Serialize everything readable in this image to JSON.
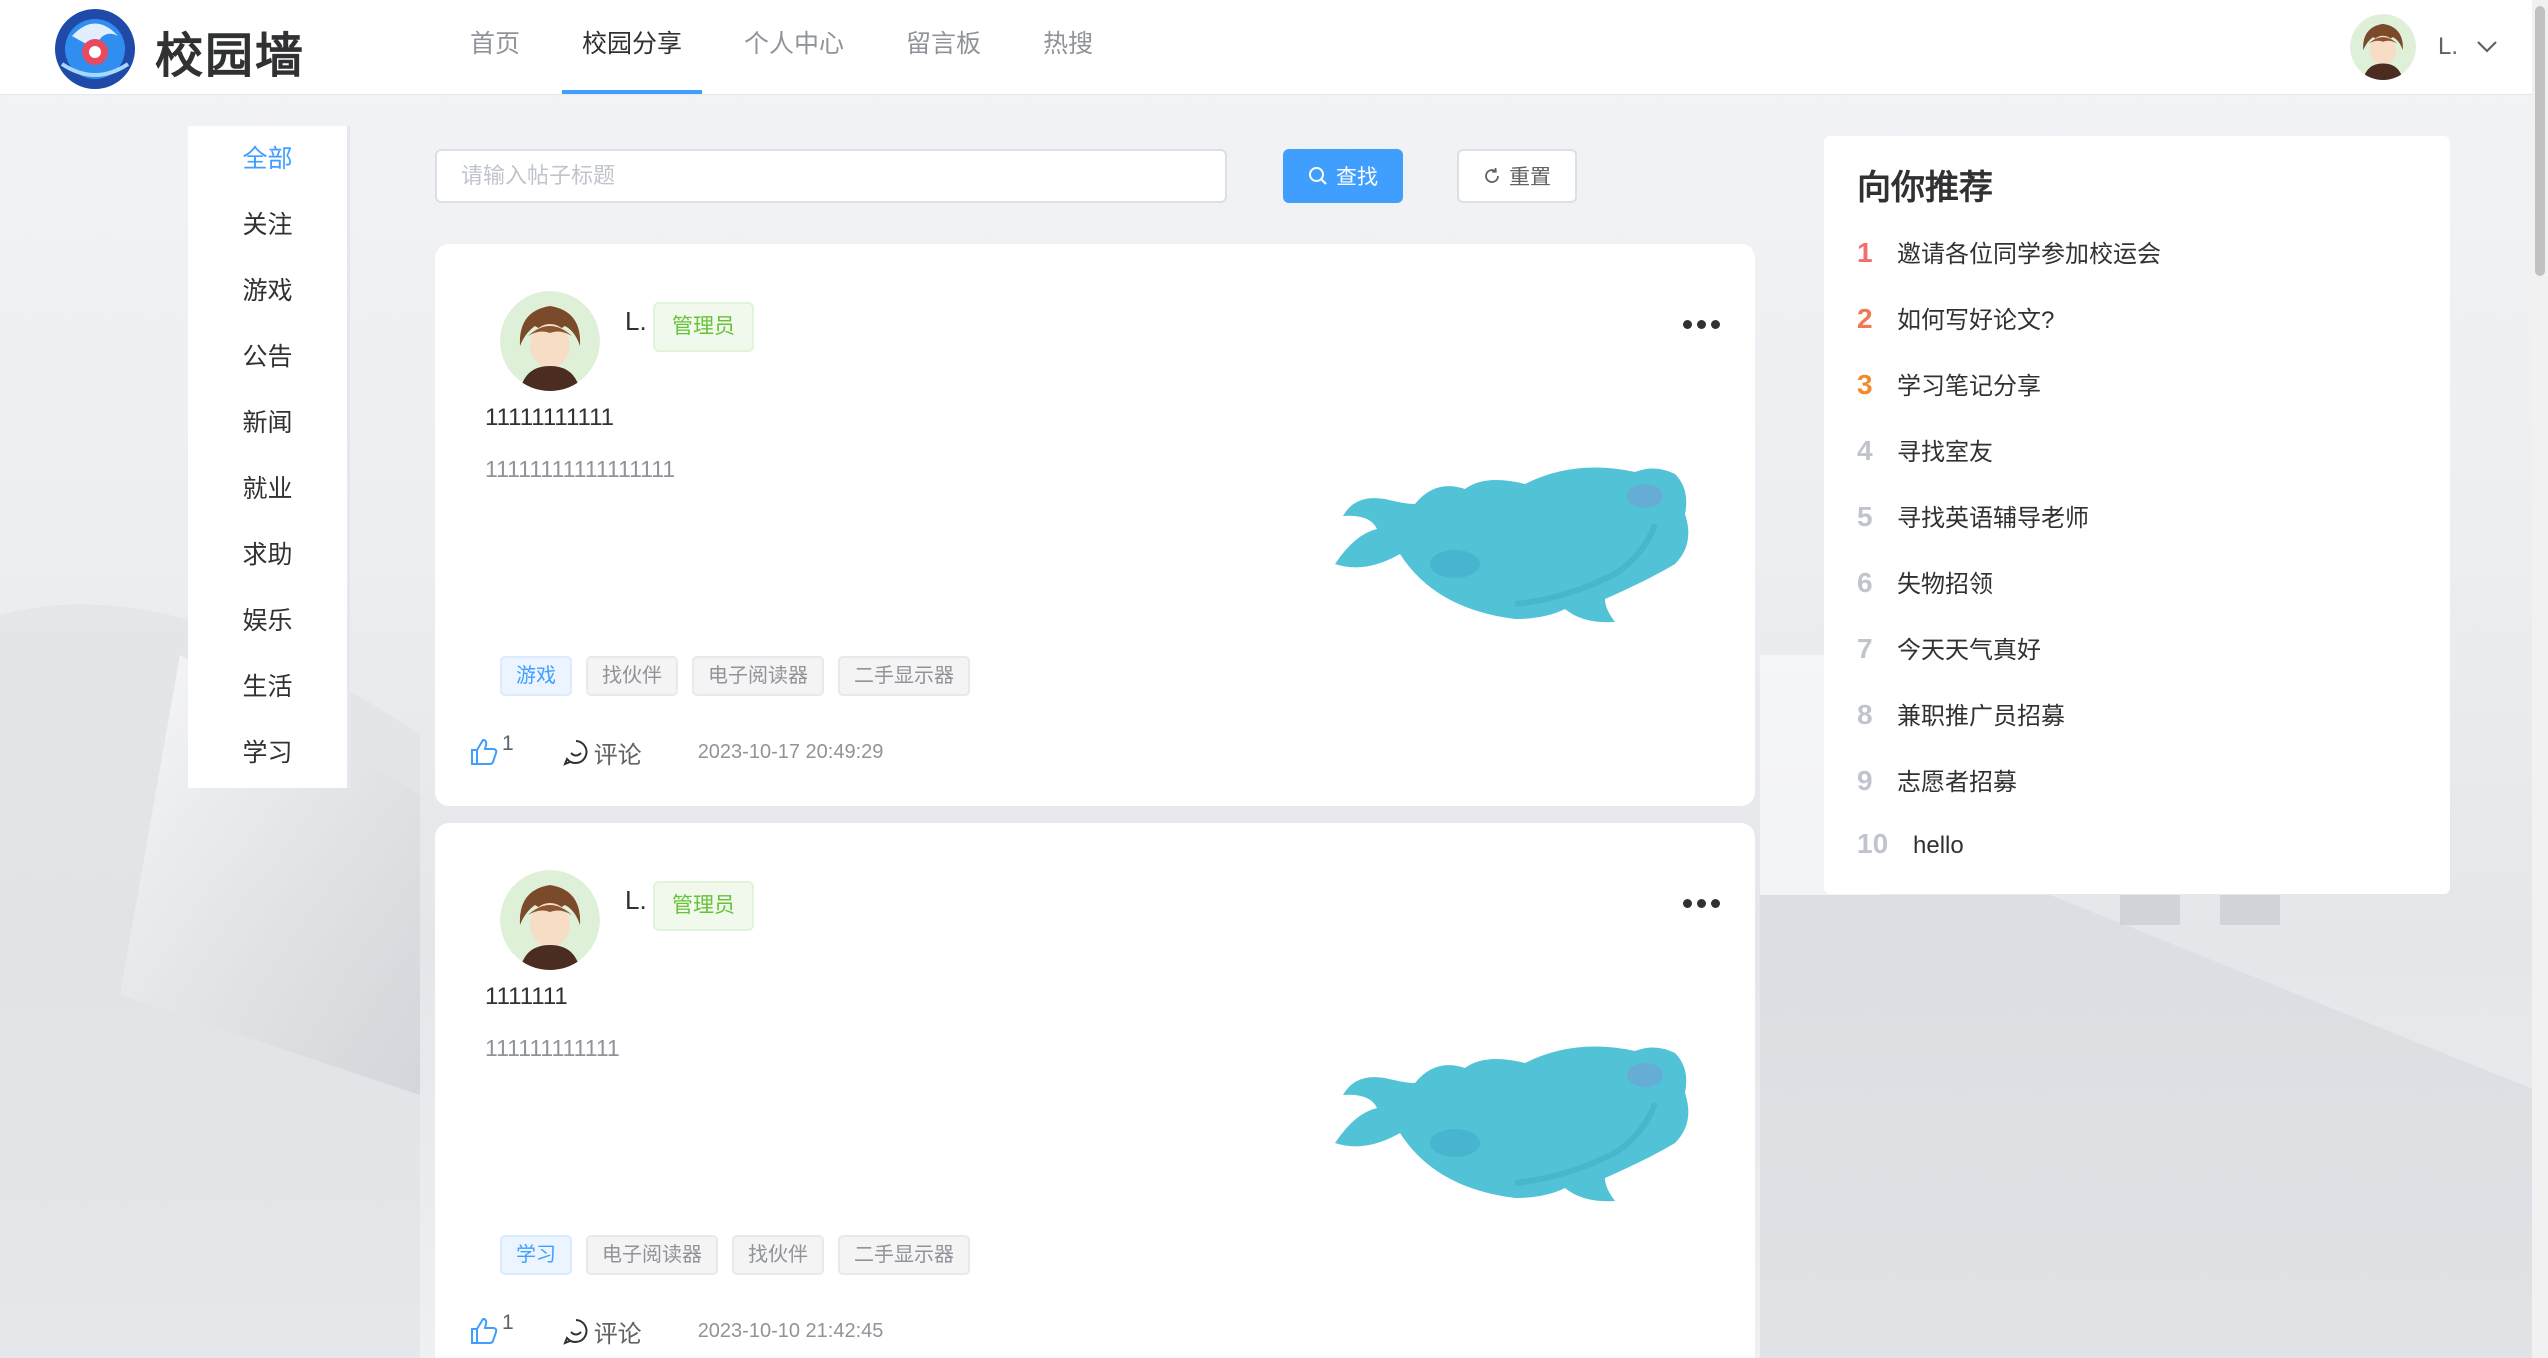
{
  "header": {
    "brand": "校园墙",
    "nav": [
      "首页",
      "校园分享",
      "个人中心",
      "留言板",
      "热搜"
    ],
    "active_nav": "校园分享",
    "user_name": "L."
  },
  "categories": [
    "全部",
    "关注",
    "游戏",
    "公告",
    "新闻",
    "就业",
    "求助",
    "娱乐",
    "生活",
    "学习"
  ],
  "active_category": "全部",
  "search": {
    "placeholder": "请输入帖子标题",
    "search_label": "查找",
    "reset_label": "重置"
  },
  "posts": [
    {
      "user": "L.",
      "role": "管理员",
      "title": "11111111111",
      "content": "11111111111111111",
      "tags": [
        "游戏",
        "找伙伴",
        "电子阅读器",
        "二手显示器"
      ],
      "likes": "1",
      "comment_label": "评论",
      "time": "2023-10-17 20:49:29"
    },
    {
      "user": "L.",
      "role": "管理员",
      "title": "1111111",
      "content": "111111111111",
      "tags": [
        "学习",
        "电子阅读器",
        "找伙伴",
        "二手显示器"
      ],
      "likes": "1",
      "comment_label": "评论",
      "time": "2023-10-10 21:42:45"
    }
  ],
  "recommend": {
    "title": "向你推荐",
    "items": [
      {
        "rank": "1",
        "text": "邀请各位同学参加校运会"
      },
      {
        "rank": "2",
        "text": "如何写好论文?"
      },
      {
        "rank": "3",
        "text": "学习笔记分享"
      },
      {
        "rank": "4",
        "text": "寻找室友"
      },
      {
        "rank": "5",
        "text": "寻找英语辅导老师"
      },
      {
        "rank": "6",
        "text": "失物招领"
      },
      {
        "rank": "7",
        "text": "今天天气真好"
      },
      {
        "rank": "8",
        "text": "兼职推广员招募"
      },
      {
        "rank": "9",
        "text": "志愿者招募"
      },
      {
        "rank": "10",
        "text": "hello"
      }
    ]
  },
  "colors": {
    "primary": "#409eff",
    "success": "#67c23a",
    "rank_1": "#f56c6c",
    "rank_2": "#f17850",
    "rank_3": "#f28b30"
  }
}
